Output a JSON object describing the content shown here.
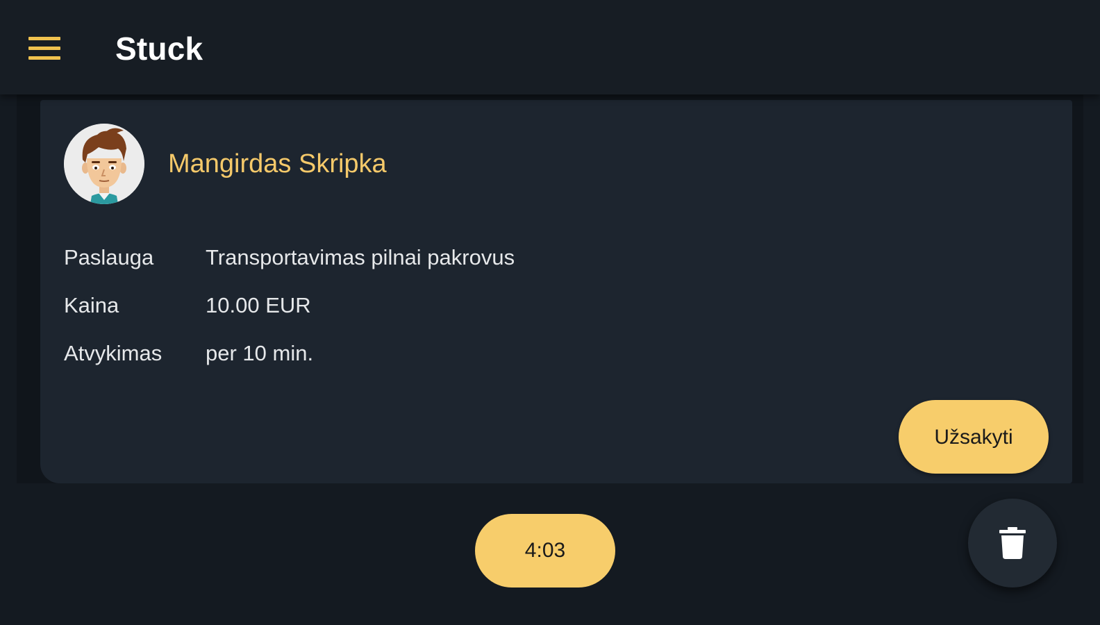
{
  "appbar": {
    "title": "Stuck",
    "menu_icon": "hamburger-menu-icon"
  },
  "card": {
    "avatar_icon": "cartoon-man-avatar",
    "driver_name": "Mangirdas Skripka",
    "details": [
      {
        "label": "Paslauga",
        "value": "Transportavimas pilnai pakrovus"
      },
      {
        "label": "Kaina",
        "value": "10.00 EUR"
      },
      {
        "label": "Atvykimas",
        "value": "per 10 min."
      }
    ],
    "order_button_label": "Užsakyti"
  },
  "timer": {
    "value": "4:03"
  },
  "fab": {
    "icon": "trash-icon"
  },
  "colors": {
    "accent": "#f7cd6b",
    "name_text": "#f5c96a",
    "background": "#141a21",
    "card": "#1d252f"
  }
}
